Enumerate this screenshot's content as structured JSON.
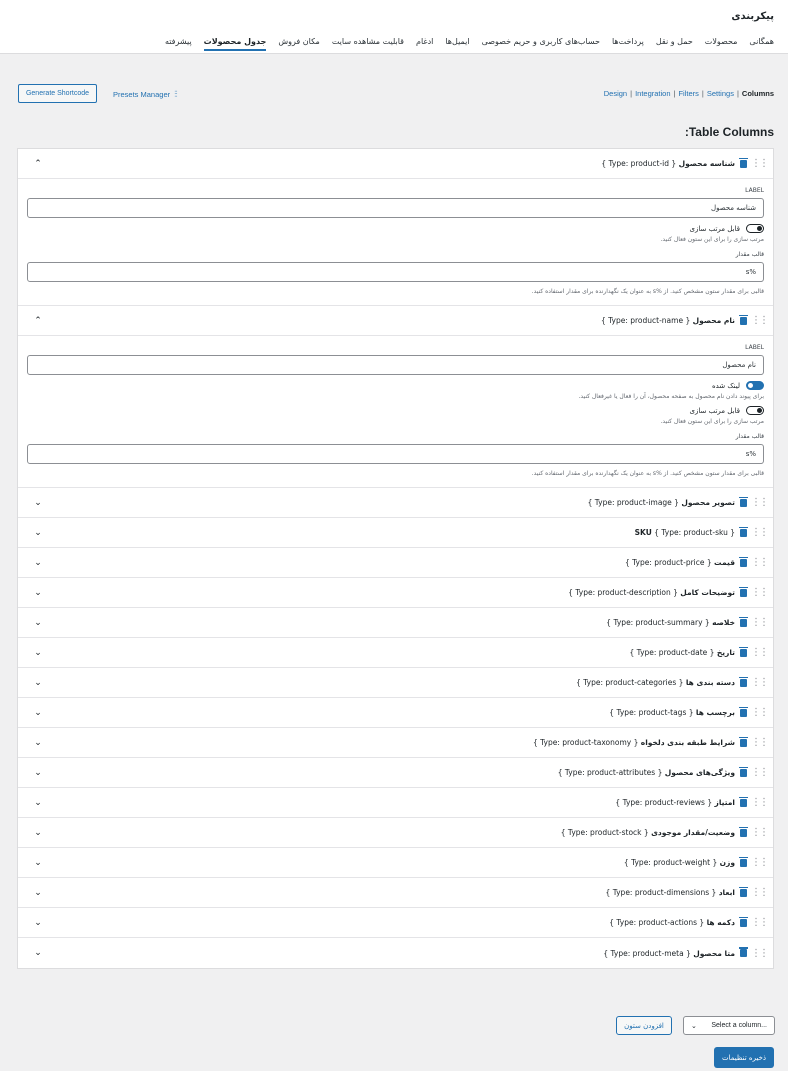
{
  "page": {
    "title": "پیکربندی"
  },
  "tabs": [
    {
      "label": "همگانی",
      "active": false
    },
    {
      "label": "محصولات",
      "active": false
    },
    {
      "label": "حمل و نقل",
      "active": false
    },
    {
      "label": "پرداخت‌ها",
      "active": false
    },
    {
      "label": "حساب‌های کاربری و حریم خصوصی",
      "active": false
    },
    {
      "label": "ایمیل‌ها",
      "active": false
    },
    {
      "label": "ادغام",
      "active": false
    },
    {
      "label": "قابلیت مشاهده سایت",
      "active": false
    },
    {
      "label": "مکان فروش",
      "active": false
    },
    {
      "label": "جدول محصولات",
      "active": true
    },
    {
      "label": "پیشرفته",
      "active": false
    }
  ],
  "toolbar": {
    "generate_label": "Generate Shortcode",
    "presets_label": "Presets Manager"
  },
  "subnav": {
    "design": "Design",
    "integration": "Integration",
    "filters": "Filters",
    "settings": "Settings",
    "columns": "Columns",
    "sep": "|"
  },
  "section": {
    "title": ":Table Columns"
  },
  "col1": {
    "title": "شناسه محصول",
    "type": "{ Type: product-id }",
    "label_caption": "LABEL",
    "label_value": "شناسه محصول",
    "sortable_label": "قابل مرتب سازی",
    "sortable_help": "مرتب سازی را برای این ستون فعال کنید.",
    "template_label": "قالب مقدار",
    "template_value": "%s",
    "template_help": "قالبی برای مقدار ستون مشخص کنید. از %s به عنوان یک نگهدارنده برای مقدار استفاده کنید."
  },
  "col2": {
    "title": "نام محصول",
    "type": "{ Type: product-name }",
    "label_caption": "LABEL",
    "label_value": "نام محصول",
    "linked_label": "لینک شده",
    "linked_help": "برای پیوند دادن نام محصول به صفحه محصول، آن را فعال یا غیرفعال کنید.",
    "sortable_label": "قابل مرتب سازی",
    "sortable_help": "مرتب سازی را برای این ستون فعال کنید.",
    "template_label": "قالب مقدار",
    "template_value": "%s",
    "template_help": "قالبی برای مقدار ستون مشخص کنید. از %s به عنوان یک نگهدارنده برای مقدار استفاده کنید."
  },
  "collapsed": [
    {
      "title": "تصویر محصول",
      "type": "{ Type: product-image }"
    },
    {
      "title": "SKU",
      "type": "{ Type: product-sku }"
    },
    {
      "title": "قیمت",
      "type": "{ Type: product-price }"
    },
    {
      "title": "توضیحات کامل",
      "type": "{ Type: product-description }"
    },
    {
      "title": "خلاصه",
      "type": "{ Type: product-summary }"
    },
    {
      "title": "تاریخ",
      "type": "{ Type: product-date }"
    },
    {
      "title": "دسته بندی ها",
      "type": "{ Type: product-categories }"
    },
    {
      "title": "برچسب ها",
      "type": "{ Type: product-tags }"
    },
    {
      "title": "شرایط طبقه بندی دلخواه",
      "type": "{ Type: product-taxonomy }"
    },
    {
      "title": "ویژگی‌های محصول",
      "type": "{ Type: product-attributes }"
    },
    {
      "title": "امتیاز",
      "type": "{ Type: product-reviews }"
    },
    {
      "title": "وضعیت/مقدار موجودی",
      "type": "{ Type: product-stock }"
    },
    {
      "title": "وزن",
      "type": "{ Type: product-weight }"
    },
    {
      "title": "ابعاد",
      "type": "{ Type: product-dimensions }"
    },
    {
      "title": "دکمه ها",
      "type": "{ Type: product-actions }"
    },
    {
      "title": "متا محصول",
      "type": "{ Type: product-meta }"
    }
  ],
  "footer": {
    "select_placeholder": "Select a column...",
    "add_label": "افزودن ستون",
    "save_label": "ذخیره تنظیمات"
  },
  "colors": {
    "accent": "#2271b1",
    "background": "#f0f0f1"
  },
  "icons": {
    "drag": "drag-handle-icon",
    "trash": "trash-icon",
    "chevron_up": "chevron-up-icon",
    "chevron_down": "chevron-down-icon",
    "presets": "sliders-icon"
  }
}
